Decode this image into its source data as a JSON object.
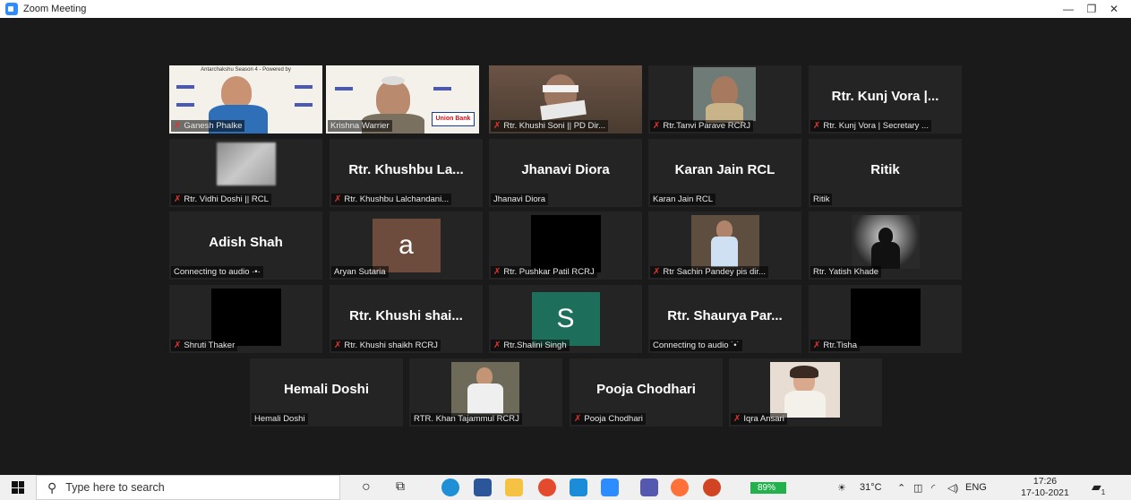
{
  "window": {
    "title": "Zoom Meeting"
  },
  "tiles": [
    {
      "name": "Ganesh Phalke",
      "muted": true
    },
    {
      "name": "Krishna Warrier",
      "muted": false
    },
    {
      "name": "Rtr. Khushi Soni || PD Dir...",
      "muted": true
    },
    {
      "name": "Rtr.Tanvi Parave RCRJ",
      "muted": true
    },
    {
      "big": "Rtr. Kunj Vora |...",
      "name": "Rtr. Kunj Vora | Secretary ...",
      "muted": true
    },
    {
      "name": "Rtr. Vidhi Doshi || RCL",
      "muted": true
    },
    {
      "big": "Rtr. Khushbu La...",
      "name": "Rtr. Khushbu Lalchandani...",
      "muted": true
    },
    {
      "big": "Jhanavi Diora",
      "name": "Jhanavi Diora",
      "muted": false
    },
    {
      "big": "Karan Jain RCL",
      "name": "Karan Jain RCL",
      "muted": false
    },
    {
      "big": "Ritik",
      "name": "Ritik",
      "muted": false
    },
    {
      "big": "Adish Shah",
      "name": "Connecting to audio ·•·",
      "muted": false
    },
    {
      "letter": "a",
      "name": "Aryan Sutaria",
      "muted": false
    },
    {
      "name": "Rtr. Pushkar Patil RCRJ",
      "muted": true
    },
    {
      "name": "Rtr Sachin Pandey pis dir...",
      "muted": true
    },
    {
      "name": "Rtr. Yatish Khade",
      "muted": false
    },
    {
      "name": "Shruti Thaker",
      "muted": true
    },
    {
      "big": "Rtr. Khushi shai...",
      "name": "Rtr. Khushi shaikh RCRJ",
      "muted": true
    },
    {
      "letter": "S",
      "name": "Rtr.Shalini Singh",
      "muted": true
    },
    {
      "big": "Rtr. Shaurya Par...",
      "name": "Connecting to audio ˙•˙",
      "muted": false
    },
    {
      "name": "Rtr.Tisha",
      "muted": true
    },
    {
      "big": "Hemali Doshi",
      "name": "Hemali Doshi",
      "muted": false
    },
    {
      "name": "RTR. Khan Tajammul RCRJ",
      "muted": false
    },
    {
      "big": "Pooja Chodhari",
      "name": "Pooja Chodhari",
      "muted": true
    },
    {
      "name": "Iqra Ansari",
      "muted": true
    }
  ],
  "slide": {
    "header": "Antarchakshu Season 4 - Powered by",
    "sponsor": "Union Bank"
  },
  "taskbar": {
    "search_placeholder": "Type here to search",
    "battery": "89%",
    "weather": "31°C",
    "language": "ENG",
    "time": "17:26",
    "date": "17-10-2021",
    "notifications": "1"
  },
  "colors": {
    "active_speaker": "#c6d83a",
    "mute": "#e0342c",
    "letter_a_bg": "#6d4c3d",
    "letter_s_bg": "#1d6f5b"
  }
}
